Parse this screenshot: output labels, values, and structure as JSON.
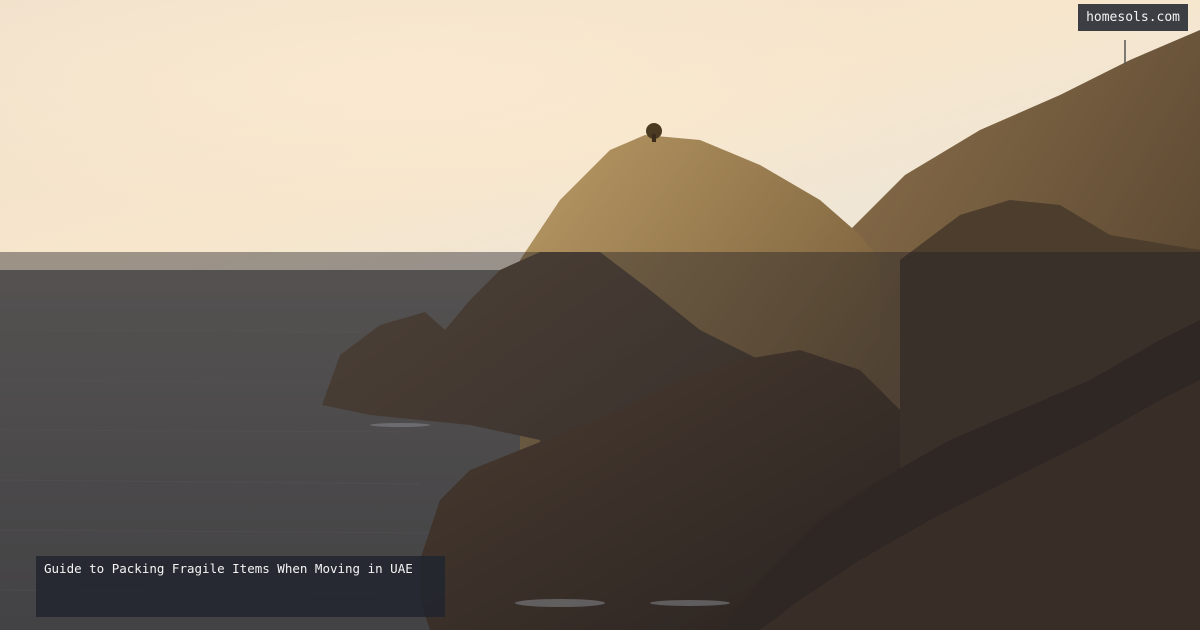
{
  "site": {
    "name": "homesols.com"
  },
  "caption": {
    "title": "Guide to Packing Fragile Items When Moving in UAE"
  },
  "scene": {
    "description_colors": {
      "sky_top": "#e8e5dc",
      "sky_bottom": "#f6e3c6",
      "sea": "#6c6a68",
      "rock_light": "#8a6d48",
      "rock_dark": "#3a2e22"
    }
  }
}
